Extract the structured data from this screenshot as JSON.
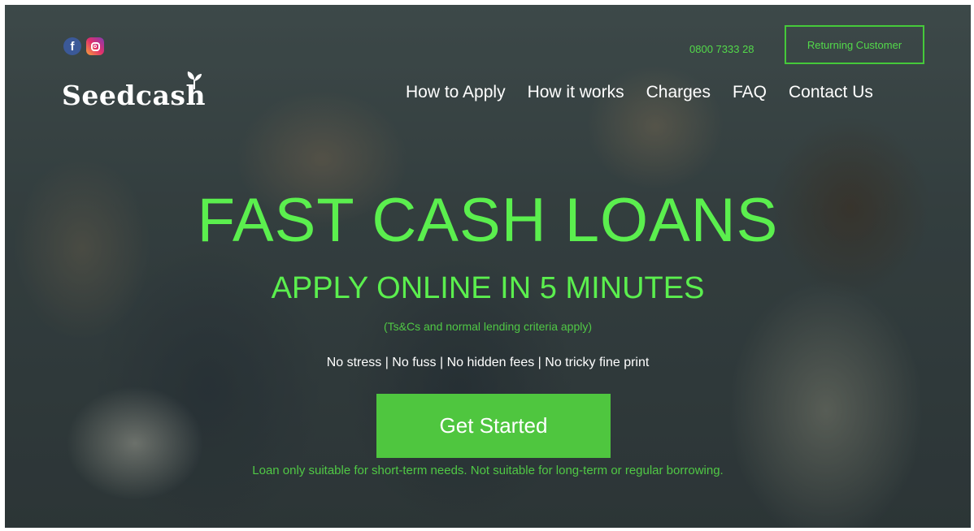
{
  "social": {
    "facebook_glyph": "f",
    "icons": [
      "facebook-icon",
      "instagram-icon"
    ]
  },
  "brand": {
    "name": "Seedcash"
  },
  "header": {
    "phone": "0800 7333 28",
    "returning_customer_label": "Returning Customer"
  },
  "nav": {
    "items": [
      {
        "label": "How to Apply"
      },
      {
        "label": "How it works"
      },
      {
        "label": "Charges"
      },
      {
        "label": "FAQ"
      },
      {
        "label": "Contact Us"
      }
    ]
  },
  "hero": {
    "headline": "FAST CASH LOANS",
    "subheadline": "APPLY ONLINE IN 5 MINUTES",
    "terms": "(Ts&Cs and normal lending criteria apply)",
    "tagline": "No stress | No fuss | No hidden fees | No tricky fine print",
    "cta_label": "Get Started",
    "disclaimer": "Loan only suitable for short-term needs. Not suitable for long-term or regular borrowing."
  },
  "colors": {
    "accent_green": "#5bef4e",
    "button_green": "#4fc63f",
    "facebook_blue": "#3b5998"
  }
}
